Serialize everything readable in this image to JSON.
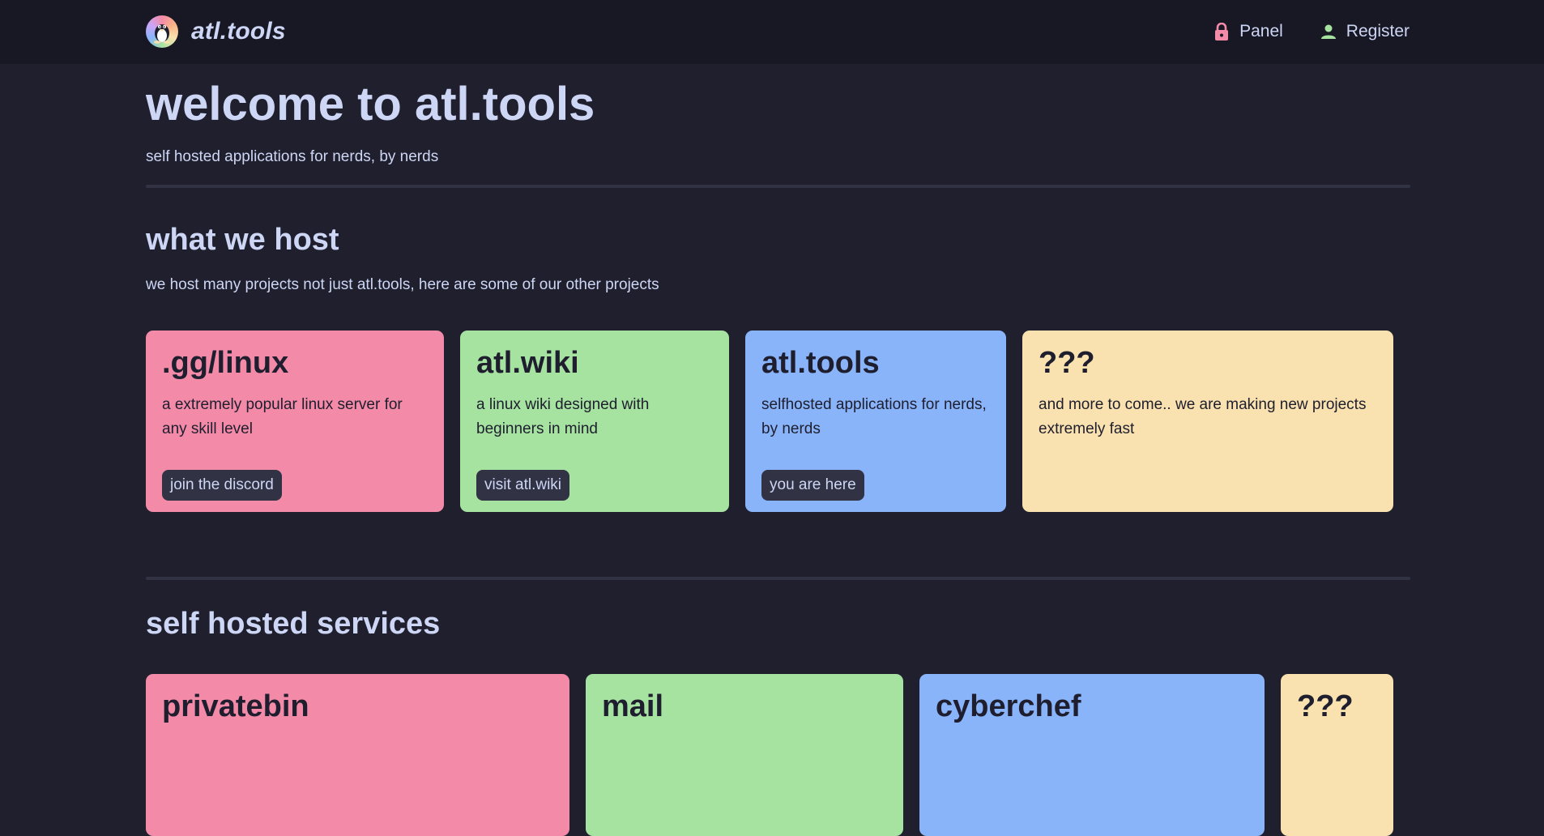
{
  "nav": {
    "brand": "atl.tools",
    "links": [
      {
        "label": "Panel",
        "icon": "lock-icon",
        "color": "#f38ba8"
      },
      {
        "label": "Register",
        "icon": "person-icon",
        "color": "#a6e3a1"
      }
    ]
  },
  "hero": {
    "title": "welcome to atl.tools",
    "subtitle": "self hosted applications for nerds, by nerds"
  },
  "host_section": {
    "title": "what we host",
    "description": "we host many projects not just atl.tools, here are some of our other projects",
    "cards": [
      {
        "title": ".gg/linux",
        "text": "a extremely popular linux server for any skill level",
        "button": "join the discord",
        "color": "#f38ba8"
      },
      {
        "title": "atl.wiki",
        "text": "a linux wiki designed with beginners in mind",
        "button": "visit atl.wiki",
        "color": "#a6e3a1"
      },
      {
        "title": "atl.tools",
        "text": "selfhosted applications for nerds, by nerds",
        "button": "you are here",
        "color": "#89b4fa"
      },
      {
        "title": "???",
        "text": "and more to come.. we are making new projects extremely fast",
        "color": "#f9e2af"
      }
    ]
  },
  "services_section": {
    "title": "self hosted services",
    "cards": [
      {
        "title": "privatebin",
        "color": "#f38ba8"
      },
      {
        "title": "mail",
        "color": "#a6e3a1"
      },
      {
        "title": "cyberchef",
        "color": "#89b4fa"
      },
      {
        "title": "???",
        "color": "#f9e2af"
      }
    ]
  }
}
